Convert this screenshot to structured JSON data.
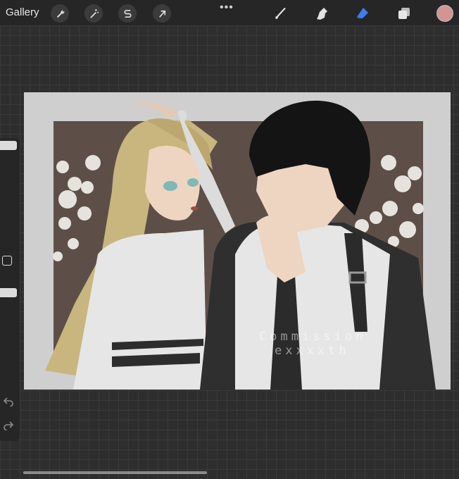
{
  "topbar": {
    "gallery_label": "Gallery",
    "left_tools": [
      "wrench-icon",
      "magic-wand-icon",
      "selection-s-icon",
      "transform-arrow-icon"
    ],
    "more_label": "•••",
    "right_tools": [
      "brush-icon",
      "smudge-icon",
      "eraser-icon",
      "layers-icon"
    ],
    "active_tool": "eraser-icon",
    "color_hex": "#d49494",
    "eraser_color": "#3f7cf0"
  },
  "artwork": {
    "watermark_line1": "Commission",
    "watermark_line2": "exxxxth"
  },
  "sidebar": {
    "controls": [
      "brush-size-slider",
      "modify-button",
      "opacity-slider",
      "undo-icon",
      "redo-icon"
    ]
  }
}
